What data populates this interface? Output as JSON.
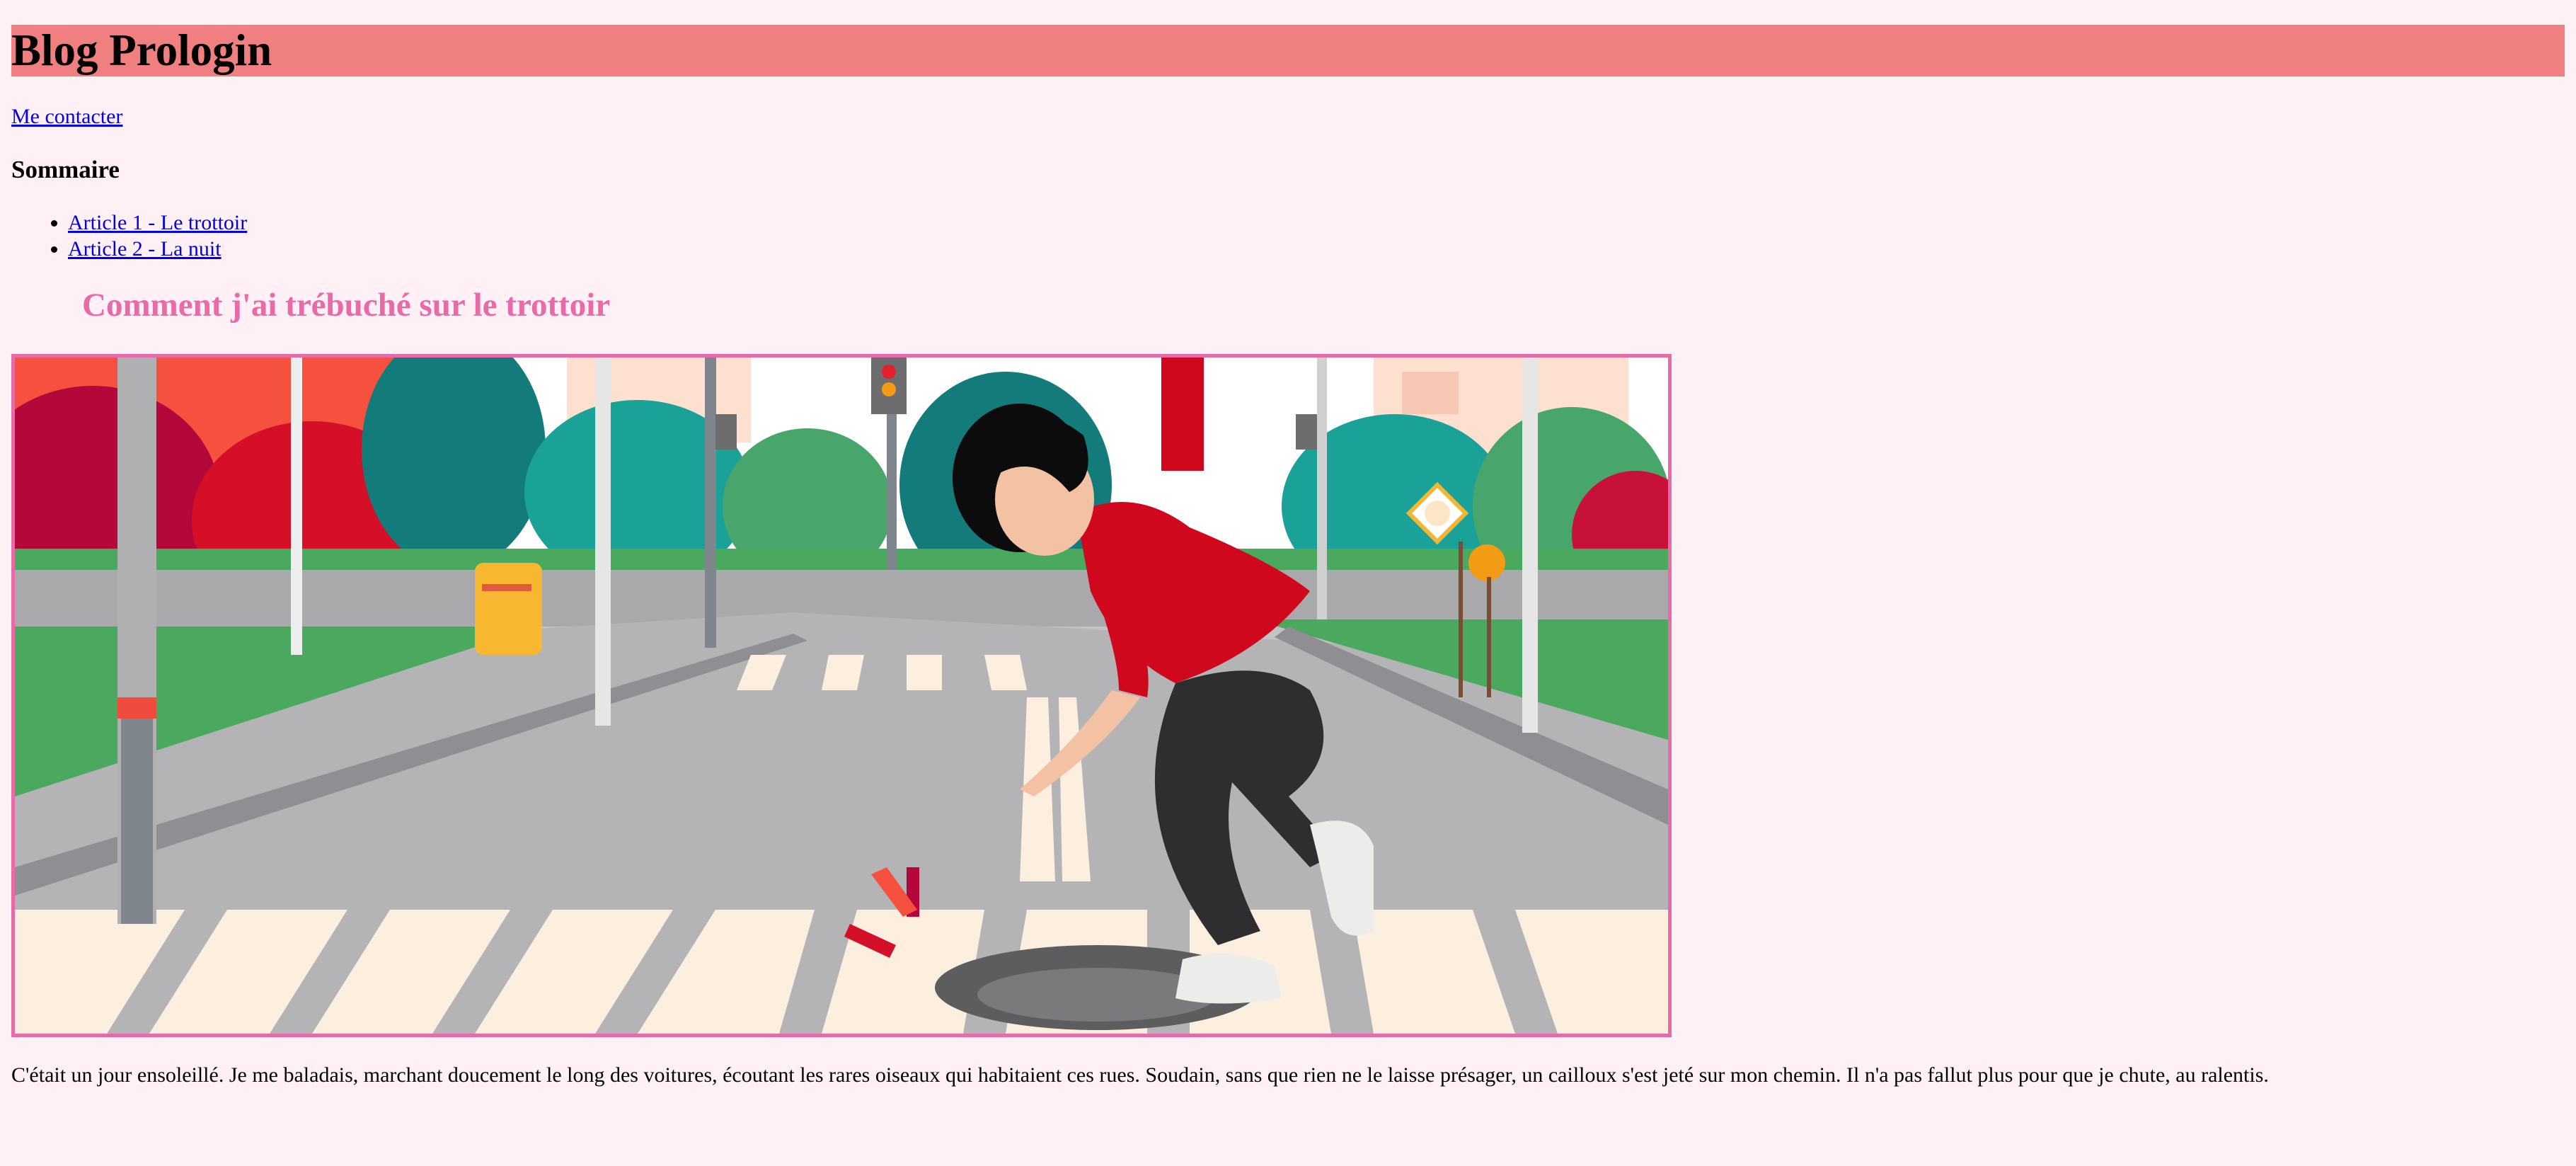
{
  "site": {
    "title": "Blog Prologin",
    "contact_link": "Me contacter"
  },
  "toc": {
    "heading": "Sommaire",
    "items": [
      {
        "label": "Article 1 - Le trottoir"
      },
      {
        "label": "Article 2 - La nuit"
      }
    ]
  },
  "article": {
    "title": "Comment j'ai trébuché sur le trottoir",
    "body": "C'était un jour ensoleillé. Je me baladais, marchant doucement le long des voitures, écoutant les rares oiseaux qui habitaient ces rues. Soudain, sans que rien ne le laisse présager, un cailloux s'est jeté sur mon chemin. Il n'a pas fallut plus pour que je chute, au ralentis."
  },
  "colors": {
    "page_background": "#fff0f5",
    "header_background": "#f08080",
    "accent_pink": "#e86aa6",
    "link_blue": "#0000ee"
  }
}
